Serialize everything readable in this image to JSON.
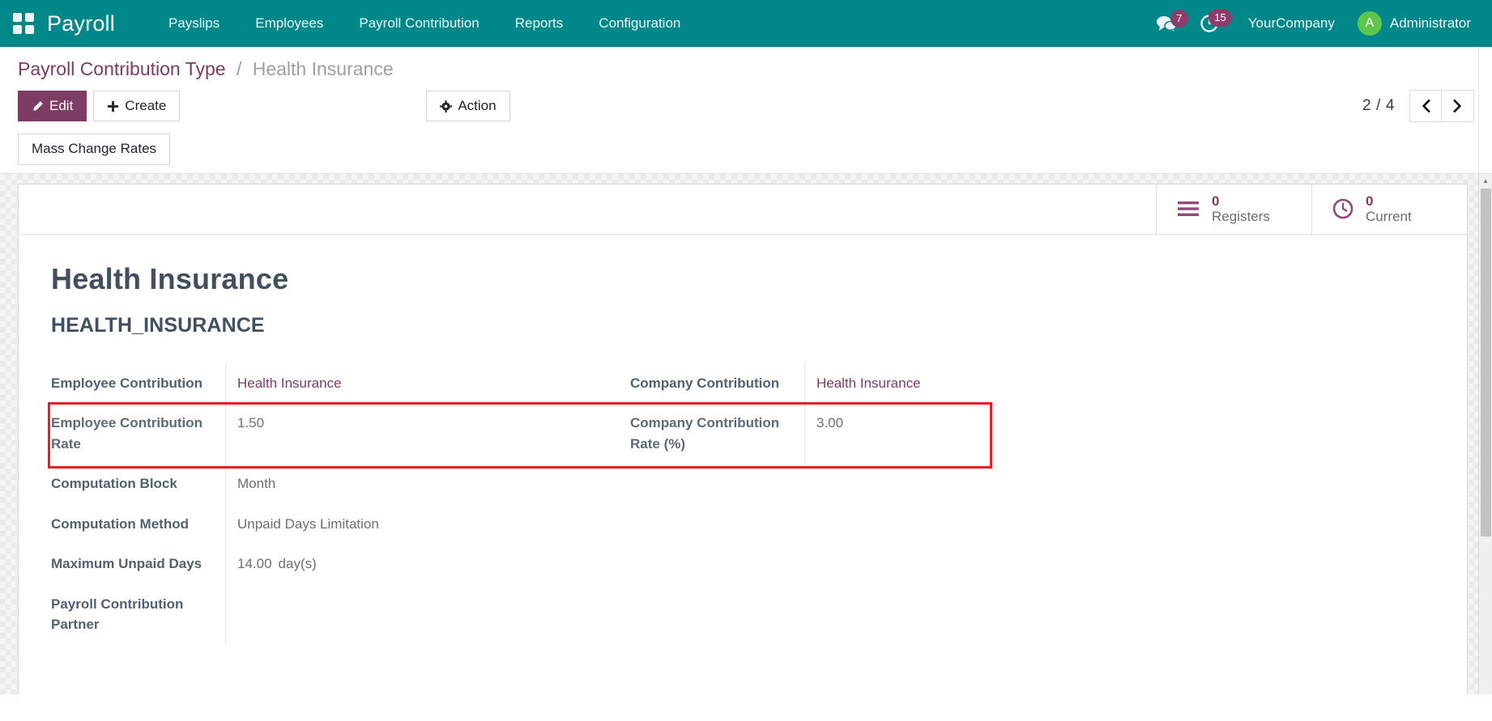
{
  "navbar": {
    "apps_icon": "apps-grid-icon",
    "brand": "Payroll",
    "menu": [
      {
        "label": "Payslips"
      },
      {
        "label": "Employees"
      },
      {
        "label": "Payroll Contribution"
      },
      {
        "label": "Reports"
      },
      {
        "label": "Configuration"
      }
    ],
    "messages_icon": "chat-bubble-icon",
    "messages_count": "7",
    "activity_icon": "clock-activity-icon",
    "activity_count": "15",
    "company": "YourCompany",
    "user_initial": "A",
    "user_name": "Administrator",
    "bg_color": "#00878a",
    "avatar_color": "#5ec64a",
    "badge_color": "#8e3c6a"
  },
  "control_panel": {
    "breadcrumb_root": "Payroll Contribution Type",
    "breadcrumb_sep": "/",
    "breadcrumb_current": "Health Insurance",
    "edit_label": "Edit",
    "edit_icon": "pencil-icon",
    "create_label": "Create",
    "create_icon": "plus-icon",
    "action_label": "Action",
    "action_icon": "gear-icon",
    "pager_counter": "2 / 4",
    "prev_icon": "chevron-left-icon",
    "next_icon": "chevron-right-icon",
    "mass_change_label": "Mass Change Rates",
    "primary_color": "#7d3c63"
  },
  "stat_buttons": [
    {
      "icon": "list-lines-icon",
      "value": "0",
      "label": "Registers"
    },
    {
      "icon": "clock-icon",
      "value": "0",
      "label": "Current"
    }
  ],
  "record": {
    "title": "Health Insurance",
    "code": "HEALTH_INSURANCE",
    "fields": [
      {
        "left_label": "Employee Contribution",
        "left_value": "Health Insurance",
        "left_is_link": true,
        "right_label": "Company Contribution",
        "right_value": "Health Insurance",
        "right_is_link": true
      },
      {
        "left_label": "Employee Contribution Rate",
        "left_value": "1.50",
        "left_is_link": false,
        "right_label": "Company Contribution Rate (%)",
        "right_value": "3.00",
        "right_is_link": false
      },
      {
        "left_label": "Computation Block",
        "left_value": "Month",
        "left_is_link": false,
        "right_label": "",
        "right_value": "",
        "right_is_link": false
      },
      {
        "left_label": "Computation Method",
        "left_value": "Unpaid Days Limitation",
        "left_is_link": false,
        "right_label": "",
        "right_value": "",
        "right_is_link": false
      },
      {
        "left_label": "Maximum Unpaid Days",
        "left_value": "14.00",
        "left_unit": "day(s)",
        "left_is_link": false,
        "right_label": "",
        "right_value": "",
        "right_is_link": false
      },
      {
        "left_label": "Payroll Contribution Partner",
        "left_value": "",
        "left_is_link": false,
        "right_label": "",
        "right_value": "",
        "right_is_link": false
      }
    ]
  },
  "annotation": {
    "highlight_color": "#ec1b24",
    "highlight_target": "contribution-rate-fields"
  },
  "scrollbar": {
    "up_arrow_icon": "triangle-up-icon"
  }
}
